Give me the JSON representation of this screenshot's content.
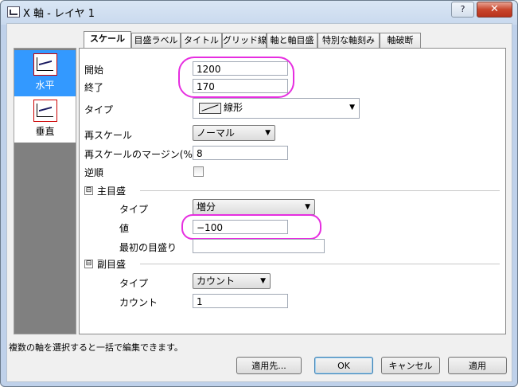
{
  "window": {
    "title": "X 軸 - レイヤ 1",
    "help_label": "?",
    "close_label": "✕"
  },
  "sidebar": {
    "items": [
      {
        "label": "水平"
      },
      {
        "label": "垂直"
      }
    ]
  },
  "tabs": [
    {
      "label": "スケール"
    },
    {
      "label": "目盛ラベル"
    },
    {
      "label": "タイトル"
    },
    {
      "label": "グリッド線"
    },
    {
      "label": "軸と軸目盛"
    },
    {
      "label": "特別な軸刻み"
    },
    {
      "label": "軸破断"
    }
  ],
  "scale": {
    "start_label": "開始",
    "start_value": "1200",
    "end_label": "終了",
    "end_value": "170",
    "type_label": "タイプ",
    "type_value": "線形",
    "rescale_label": "再スケール",
    "rescale_value": "ノーマル",
    "margin_label": "再スケールのマージン(%)",
    "margin_value": "8",
    "reverse_label": "逆順"
  },
  "major": {
    "group_label": "主目盛",
    "collapse_glyph": "⊟",
    "type_label": "タイプ",
    "type_value": "増分",
    "value_label": "値",
    "value_value": "−100",
    "first_label": "最初の目盛り",
    "first_value": ""
  },
  "minor": {
    "group_label": "副目盛",
    "collapse_glyph": "⊟",
    "type_label": "タイプ",
    "type_value": "カウント",
    "count_label": "カウント",
    "count_value": "1"
  },
  "status_text": "複数の軸を選択すると一括で編集できます。",
  "buttons": {
    "apply_to": "適用先...",
    "ok": "OK",
    "cancel": "キャンセル",
    "apply": "適用"
  },
  "colors": {
    "highlight": "#e62ee0",
    "selection": "#3399ff"
  }
}
